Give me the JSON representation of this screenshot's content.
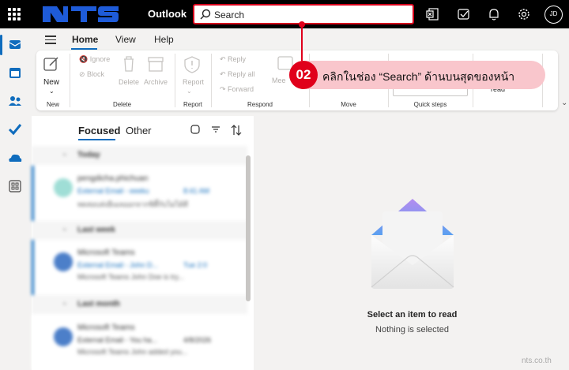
{
  "app": {
    "title": "Outlook",
    "brand": "NTS"
  },
  "search": {
    "placeholder": "Search"
  },
  "user": {
    "initials": "JD"
  },
  "menu": {
    "tabs": [
      "Home",
      "View",
      "Help"
    ]
  },
  "ribbon": {
    "new_label": "New",
    "ignore": "Ignore",
    "block": "Block",
    "delete": "Delete",
    "archive": "Archive",
    "report": "Report",
    "reply": "Reply",
    "reply_all": "Reply all",
    "forward": "Forward",
    "meeting": "Mee",
    "read": "read",
    "groups": [
      "New",
      "Delete",
      "Report",
      "Respond",
      "Move",
      "Quick steps"
    ]
  },
  "callout": {
    "number": "02",
    "text": "คลิกในช่อง “Search” ด้านบนสุดของหน้า"
  },
  "list": {
    "tabs": {
      "focused": "Focused",
      "other": "Other"
    },
    "sections": [
      "Today",
      "Last week",
      "Last month"
    ],
    "messages": [
      {
        "sender": "pengdicha.phichuan",
        "subject": "External Email - eeeku",
        "time": "8:41 AM",
        "preview": "ทดสอบส่งอีเมลออกจากซิตี้กับไม่ได้ดี"
      },
      {
        "sender": "Microsoft Teams",
        "subject": "External Email - John D...",
        "time": "Tue 2:0",
        "preview": "Microsoft Teams John Doe is try..."
      },
      {
        "sender": "Microsoft Teams",
        "subject": "External Email - You ha...",
        "time": "4/8/2026",
        "preview": "Microsoft Teams John added you..."
      }
    ]
  },
  "reading": {
    "line1": "Select an item to read",
    "line2": "Nothing is selected"
  },
  "watermark": "nts.co.th",
  "colors": {
    "accent": "#0f6cbd",
    "callout_red": "#e0001b",
    "callout_bg": "#f9c6cc"
  }
}
